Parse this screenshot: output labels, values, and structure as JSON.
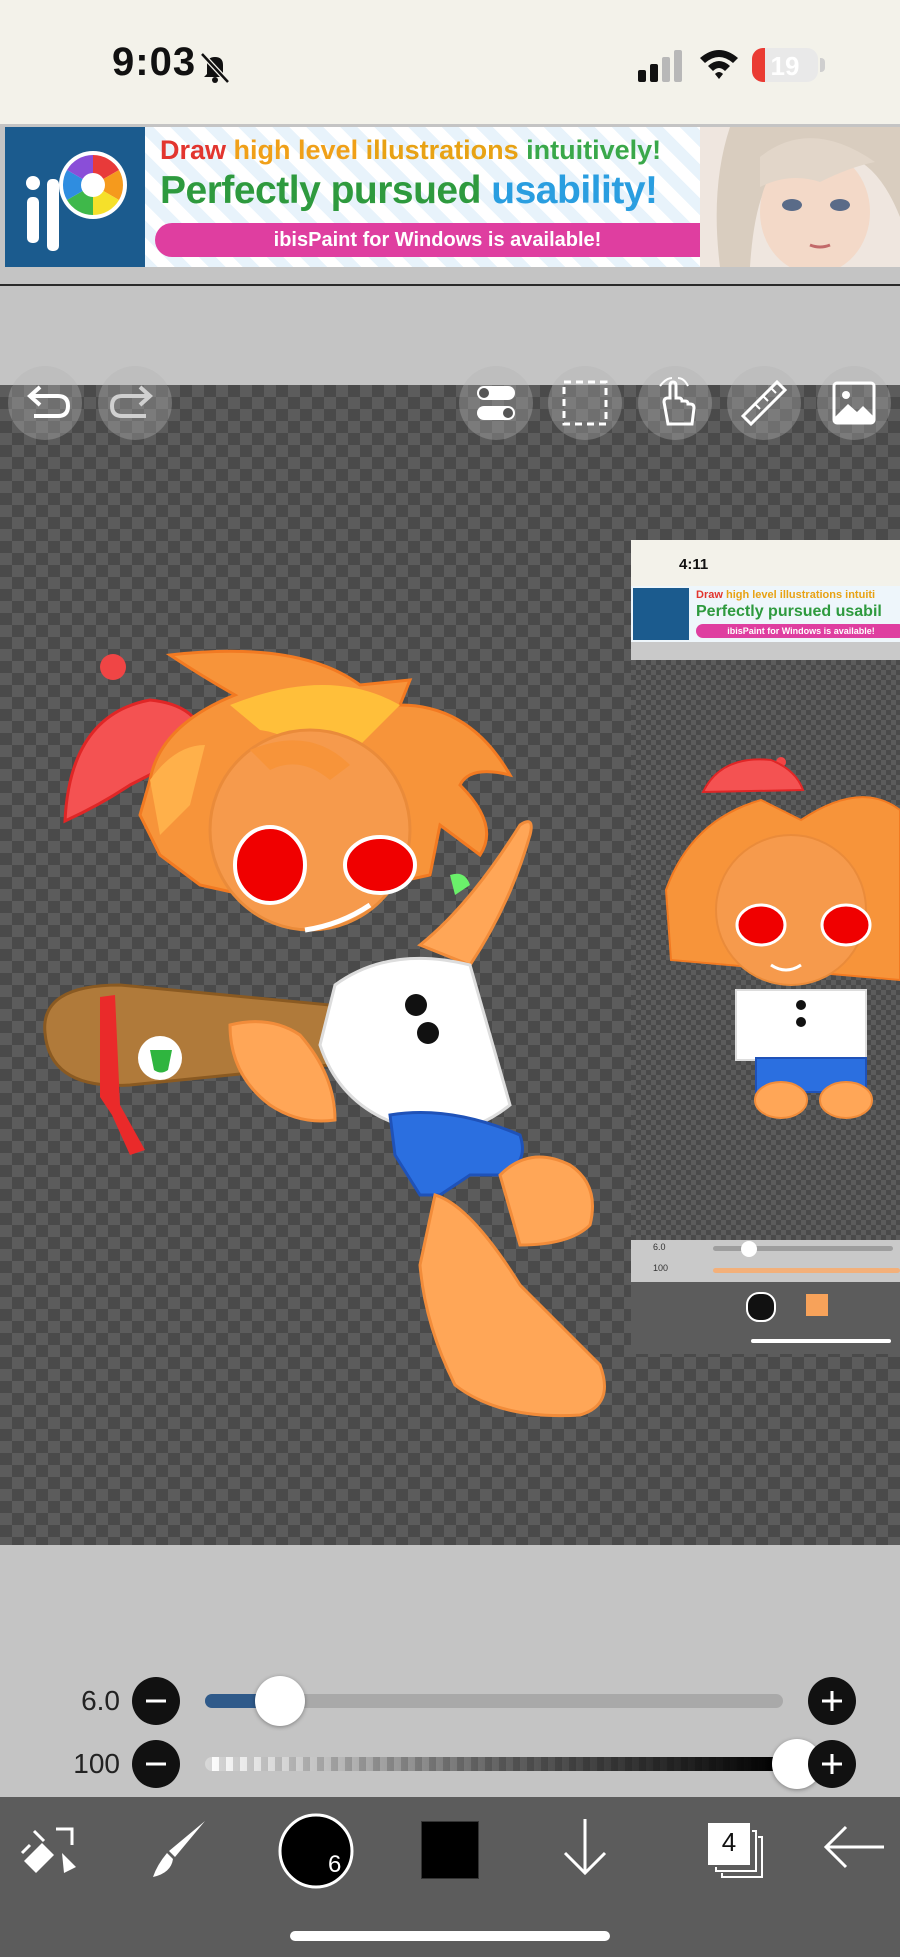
{
  "status_bar": {
    "time": "9:03",
    "battery_level": "19",
    "battery_fraction": 0.19
  },
  "ad_banner": {
    "line1_words": [
      "Draw",
      "high level",
      "illustrations",
      "intuitively!"
    ],
    "line2_words": [
      "Perfectly pursued",
      "usability!"
    ],
    "pill_text": "ibisPaint for Windows is available!",
    "colors": {
      "draw": "#e2352f",
      "high": "#f0a018",
      "illus": "#e8a214",
      "intu": "#3aa84a",
      "perfect": "#2e9a3e",
      "usab": "#2a9ee0"
    }
  },
  "toolbar": {
    "undo_icon": "undo-icon",
    "redo_icon": "redo-icon",
    "toggle_icon": "toggle-icon",
    "selection_icon": "selection-icon",
    "hand_icon": "hand-icon",
    "ruler_icon": "ruler-icon",
    "image_icon": "image-icon"
  },
  "reference_window": {
    "time": "4:11",
    "line1_words": [
      "Draw",
      "high level illustrations intuiti"
    ],
    "line2": "Perfectly pursued usabil",
    "pill_text": "ibisPaint for Windows is available!",
    "brush_size": "6.0",
    "opacity": "100"
  },
  "brush_size": {
    "value": "6.0",
    "fraction": 0.13
  },
  "opacity": {
    "value": "100",
    "fraction": 1.0
  },
  "bottom_bar": {
    "brush_number": "6",
    "layer_count": "4",
    "primary_color": "#000000"
  }
}
